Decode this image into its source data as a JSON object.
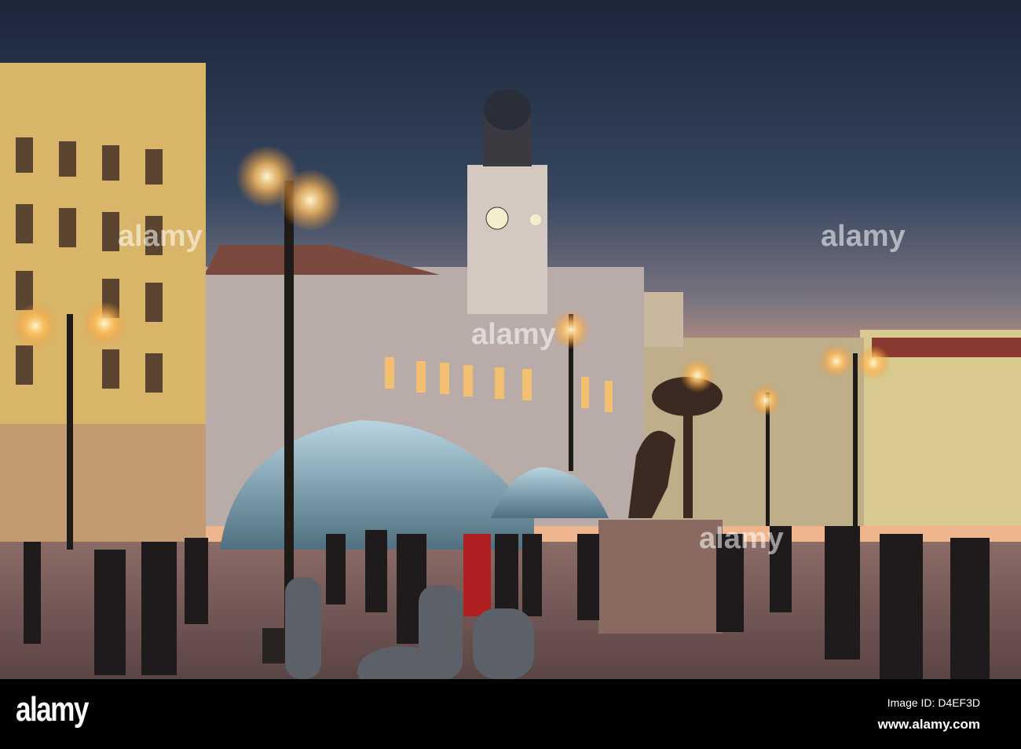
{
  "photo": {
    "description_label": "Puerta del Sol at dusk"
  },
  "watermark": {
    "text": "alamy"
  },
  "footer": {
    "logo": "alamy",
    "image_id": "Image ID: D4EF3D",
    "website": "www.alamy.com"
  },
  "colors": {
    "sky_top": "#1e2a3e",
    "sky_horizon": "#e8a27a",
    "building_left": "#d9b56a",
    "ground": "#6f5552",
    "bar": "#000000"
  }
}
